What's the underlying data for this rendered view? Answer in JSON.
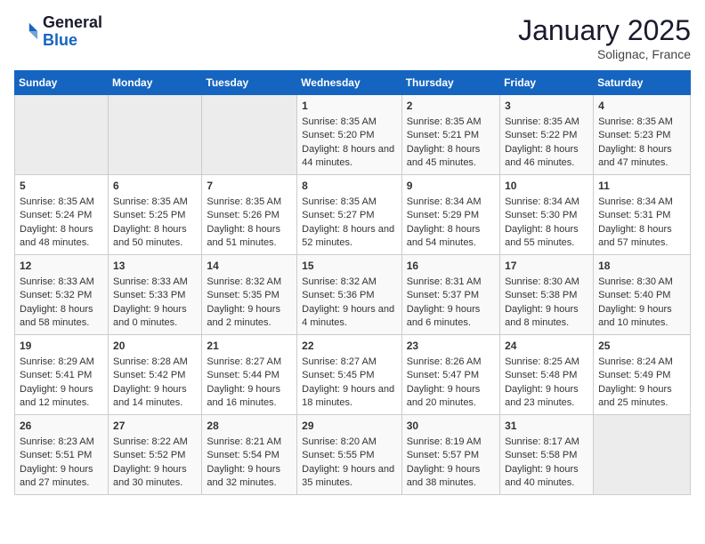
{
  "header": {
    "logo_general": "General",
    "logo_blue": "Blue",
    "month_year": "January 2025",
    "location": "Solignac, France"
  },
  "weekdays": [
    "Sunday",
    "Monday",
    "Tuesday",
    "Wednesday",
    "Thursday",
    "Friday",
    "Saturday"
  ],
  "weeks": [
    [
      {
        "day": "",
        "empty": true
      },
      {
        "day": "",
        "empty": true
      },
      {
        "day": "",
        "empty": true
      },
      {
        "day": "1",
        "sunrise": "8:35 AM",
        "sunset": "5:20 PM",
        "daylight": "8 hours and 44 minutes."
      },
      {
        "day": "2",
        "sunrise": "8:35 AM",
        "sunset": "5:21 PM",
        "daylight": "8 hours and 45 minutes."
      },
      {
        "day": "3",
        "sunrise": "8:35 AM",
        "sunset": "5:22 PM",
        "daylight": "8 hours and 46 minutes."
      },
      {
        "day": "4",
        "sunrise": "8:35 AM",
        "sunset": "5:23 PM",
        "daylight": "8 hours and 47 minutes."
      }
    ],
    [
      {
        "day": "5",
        "sunrise": "8:35 AM",
        "sunset": "5:24 PM",
        "daylight": "8 hours and 48 minutes."
      },
      {
        "day": "6",
        "sunrise": "8:35 AM",
        "sunset": "5:25 PM",
        "daylight": "8 hours and 50 minutes."
      },
      {
        "day": "7",
        "sunrise": "8:35 AM",
        "sunset": "5:26 PM",
        "daylight": "8 hours and 51 minutes."
      },
      {
        "day": "8",
        "sunrise": "8:35 AM",
        "sunset": "5:27 PM",
        "daylight": "8 hours and 52 minutes."
      },
      {
        "day": "9",
        "sunrise": "8:34 AM",
        "sunset": "5:29 PM",
        "daylight": "8 hours and 54 minutes."
      },
      {
        "day": "10",
        "sunrise": "8:34 AM",
        "sunset": "5:30 PM",
        "daylight": "8 hours and 55 minutes."
      },
      {
        "day": "11",
        "sunrise": "8:34 AM",
        "sunset": "5:31 PM",
        "daylight": "8 hours and 57 minutes."
      }
    ],
    [
      {
        "day": "12",
        "sunrise": "8:33 AM",
        "sunset": "5:32 PM",
        "daylight": "8 hours and 58 minutes."
      },
      {
        "day": "13",
        "sunrise": "8:33 AM",
        "sunset": "5:33 PM",
        "daylight": "9 hours and 0 minutes."
      },
      {
        "day": "14",
        "sunrise": "8:32 AM",
        "sunset": "5:35 PM",
        "daylight": "9 hours and 2 minutes."
      },
      {
        "day": "15",
        "sunrise": "8:32 AM",
        "sunset": "5:36 PM",
        "daylight": "9 hours and 4 minutes."
      },
      {
        "day": "16",
        "sunrise": "8:31 AM",
        "sunset": "5:37 PM",
        "daylight": "9 hours and 6 minutes."
      },
      {
        "day": "17",
        "sunrise": "8:30 AM",
        "sunset": "5:38 PM",
        "daylight": "9 hours and 8 minutes."
      },
      {
        "day": "18",
        "sunrise": "8:30 AM",
        "sunset": "5:40 PM",
        "daylight": "9 hours and 10 minutes."
      }
    ],
    [
      {
        "day": "19",
        "sunrise": "8:29 AM",
        "sunset": "5:41 PM",
        "daylight": "9 hours and 12 minutes."
      },
      {
        "day": "20",
        "sunrise": "8:28 AM",
        "sunset": "5:42 PM",
        "daylight": "9 hours and 14 minutes."
      },
      {
        "day": "21",
        "sunrise": "8:27 AM",
        "sunset": "5:44 PM",
        "daylight": "9 hours and 16 minutes."
      },
      {
        "day": "22",
        "sunrise": "8:27 AM",
        "sunset": "5:45 PM",
        "daylight": "9 hours and 18 minutes."
      },
      {
        "day": "23",
        "sunrise": "8:26 AM",
        "sunset": "5:47 PM",
        "daylight": "9 hours and 20 minutes."
      },
      {
        "day": "24",
        "sunrise": "8:25 AM",
        "sunset": "5:48 PM",
        "daylight": "9 hours and 23 minutes."
      },
      {
        "day": "25",
        "sunrise": "8:24 AM",
        "sunset": "5:49 PM",
        "daylight": "9 hours and 25 minutes."
      }
    ],
    [
      {
        "day": "26",
        "sunrise": "8:23 AM",
        "sunset": "5:51 PM",
        "daylight": "9 hours and 27 minutes."
      },
      {
        "day": "27",
        "sunrise": "8:22 AM",
        "sunset": "5:52 PM",
        "daylight": "9 hours and 30 minutes."
      },
      {
        "day": "28",
        "sunrise": "8:21 AM",
        "sunset": "5:54 PM",
        "daylight": "9 hours and 32 minutes."
      },
      {
        "day": "29",
        "sunrise": "8:20 AM",
        "sunset": "5:55 PM",
        "daylight": "9 hours and 35 minutes."
      },
      {
        "day": "30",
        "sunrise": "8:19 AM",
        "sunset": "5:57 PM",
        "daylight": "9 hours and 38 minutes."
      },
      {
        "day": "31",
        "sunrise": "8:17 AM",
        "sunset": "5:58 PM",
        "daylight": "9 hours and 40 minutes."
      },
      {
        "day": "",
        "empty": true
      }
    ]
  ]
}
